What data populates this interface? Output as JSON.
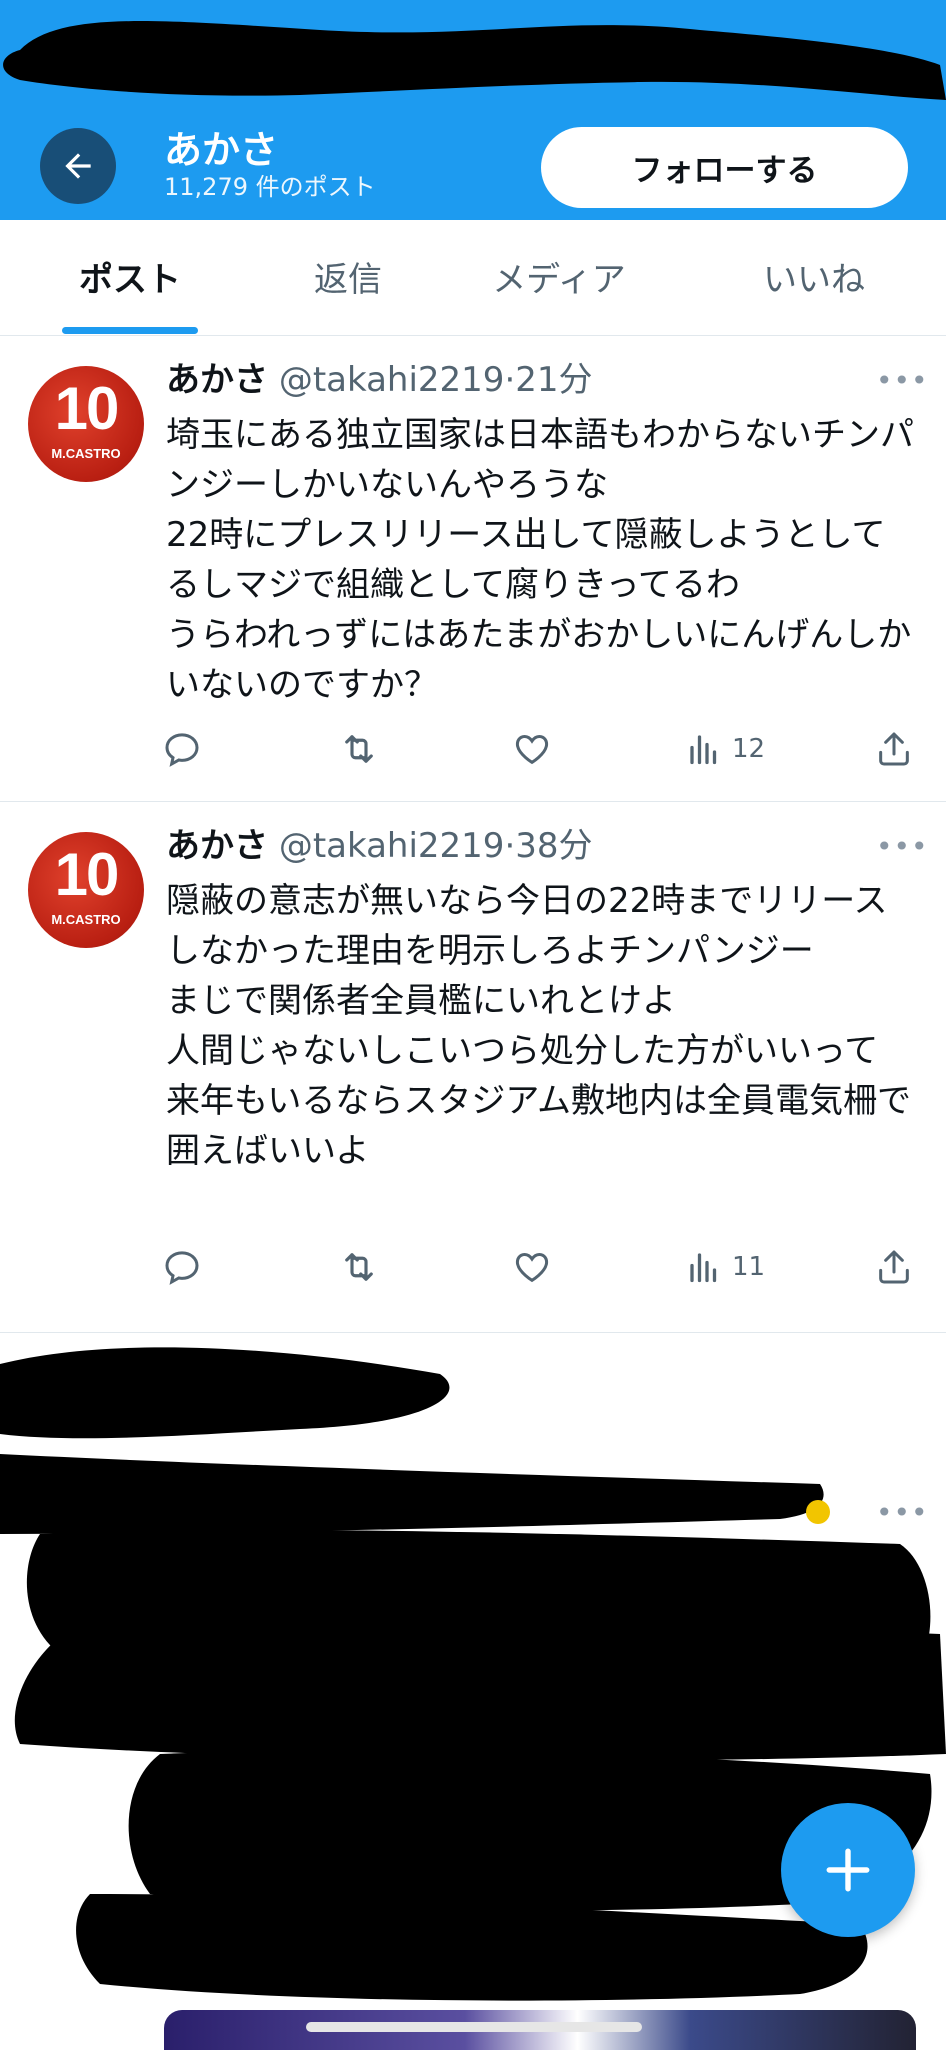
{
  "header": {
    "title": "あかさ",
    "post_count": "11,279 件のポスト",
    "follow_label": "フォローする",
    "bg_color": "#1d9bf0"
  },
  "tabs": [
    {
      "label": "ポスト",
      "active": true
    },
    {
      "label": "返信",
      "active": false
    },
    {
      "label": "メディア",
      "active": false
    },
    {
      "label": "いいね",
      "active": false
    }
  ],
  "tweets": [
    {
      "name": "あかさ",
      "handle": "@takahi2219",
      "dot": "·",
      "time": "21分",
      "text": "埼玉にある独立国家は日本語もわからないチンパンジーしかいないんやろうな\n22時にプレスリリース出して隠蔽しようとしてるしマジで組織として腐りきってるわ\nうらわれっずにはあたまがおかしいにんげんしかいないのですか？",
      "avatar": {
        "number": "10",
        "name": "M.CASTRO"
      },
      "views": "12"
    },
    {
      "name": "あかさ",
      "handle": "@takahi2219",
      "dot": "·",
      "time": "38分",
      "text": "隠蔽の意志が無いなら今日の22時までリリースしなかった理由を明示しろよチンパンジー\nまじで関係者全員檻にいれとけよ\n人間じゃないしこいつら処分した方がいいって\n来年もいるならスタジアム敷地内は全員電気柵で囲えばいいよ",
      "avatar": {
        "number": "10",
        "name": "M.CASTRO"
      },
      "views": "11"
    }
  ],
  "icons": {
    "back": "arrow-left-icon",
    "more": "more-horizontal-icon",
    "reply": "reply-icon",
    "retweet": "retweet-icon",
    "like": "heart-icon",
    "views": "views-bar-chart-icon",
    "share": "share-icon",
    "compose": "plus-icon"
  },
  "more_glyph": "•••"
}
